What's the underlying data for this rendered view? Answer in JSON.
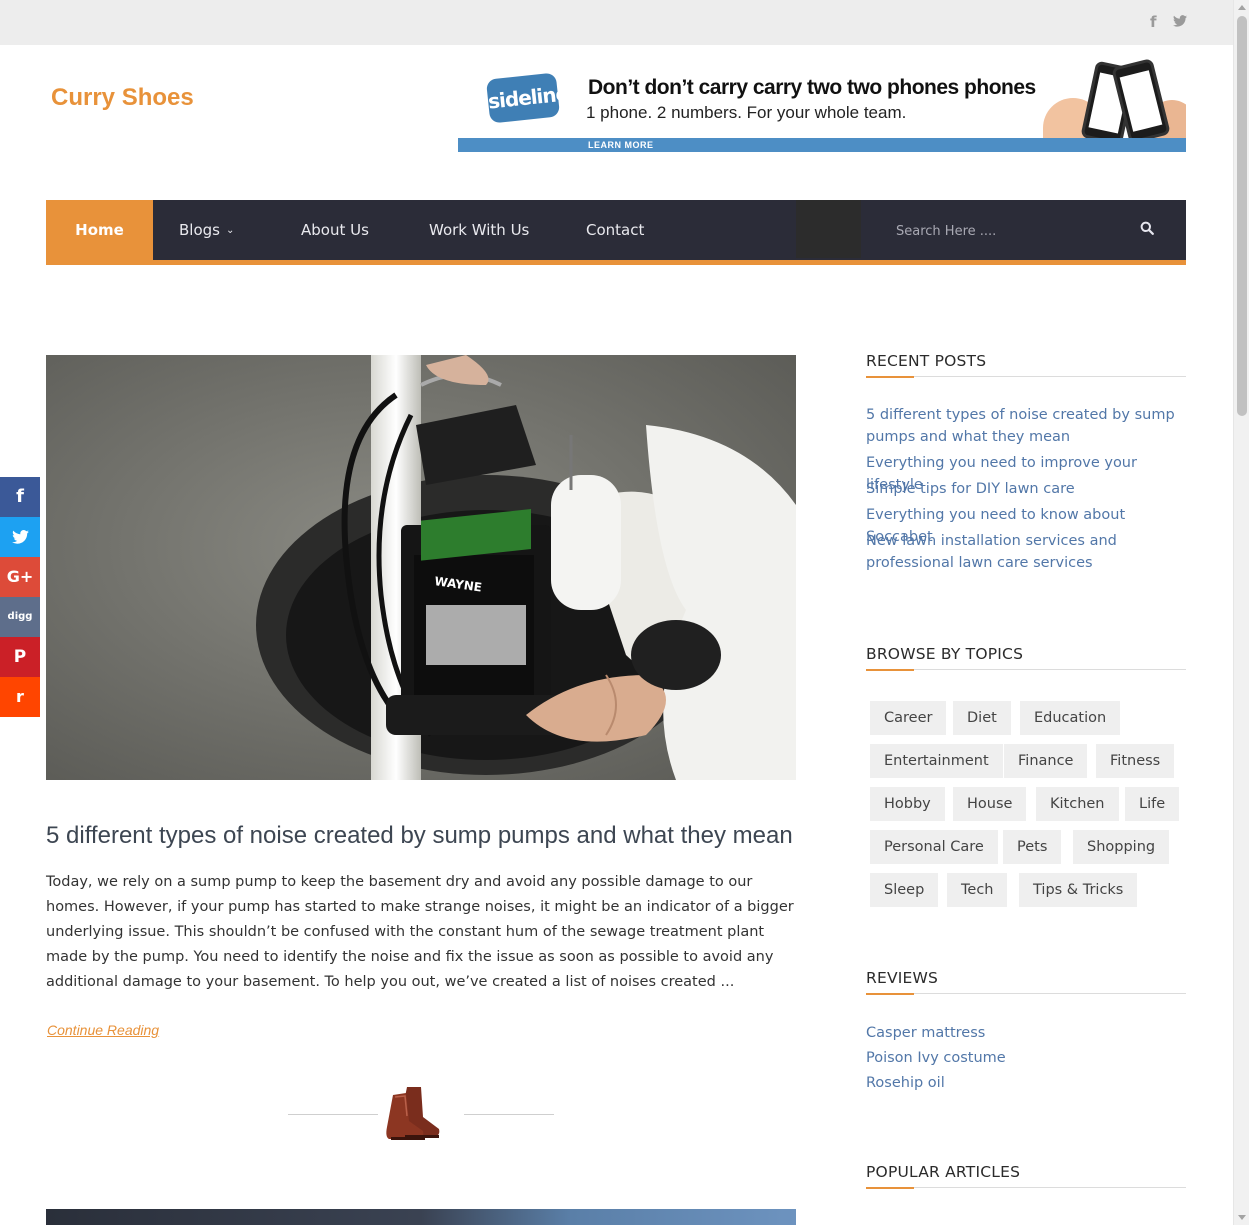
{
  "topbar": {
    "facebook_icon": "facebook-icon",
    "twitter_icon": "twitter-icon"
  },
  "site": {
    "logo": "Curry Shoes"
  },
  "ad": {
    "brand": "sideline",
    "headline": "Don’t don’t carry carry two two phones phones",
    "subline": "1 phone. 2 numbers. For your whole team.",
    "cta": "LEARN MORE"
  },
  "nav": {
    "items": [
      "Home",
      "Blogs",
      "About Us",
      "Work With Us",
      "Contact"
    ],
    "blogs_chevron": "⌄",
    "search_placeholder": "Search Here ....",
    "accent": "#e8923a",
    "bg": "#2b2c38"
  },
  "share": {
    "facebook": "f",
    "twitter": "t",
    "google": "G+",
    "digg": "digg",
    "pinterest": "P",
    "reddit": "r"
  },
  "post": {
    "title": "5 different types of noise created by sump pumps and what they mean",
    "excerpt": "Today, we rely on a sump pump to keep the basement dry and avoid any possible damage to our homes. However, if your pump has started to make strange noises, it might be an indicator of a bigger underlying issue. This shouldn’t be confused with the constant hum of the sewage treatment plant made by the pump. You need to identify the noise and fix the issue as soon as possible to avoid any additional damage to your basement. To help you out, we’ve created a list of noises created ...",
    "continue": "Continue Reading",
    "pump_label": "WAYNE"
  },
  "sidebar": {
    "recent_title": "RECENT POSTS",
    "recent": [
      "5 different types of noise created by sump pumps and what they mean",
      "Everything you need to improve your lifestyle",
      "Simple tips for DIY lawn care",
      "Everything you need to know about Soccabet",
      "New lawn installation services and professional lawn care services"
    ],
    "topics_title": "BROWSE BY TOPICS",
    "topics": [
      "Career",
      "Diet",
      "Education",
      "Entertainment",
      "Finance",
      "Fitness",
      "Hobby",
      "House",
      "Kitchen",
      "Life",
      "Personal Care",
      "Pets",
      "Shopping",
      "Sleep",
      "Tech",
      "Tips & Tricks"
    ],
    "reviews_title": "REVIEWS",
    "reviews": [
      "Casper mattress",
      "Poison Ivy costume",
      "Rosehip oil"
    ],
    "popular_title": "POPULAR ARTICLES"
  }
}
